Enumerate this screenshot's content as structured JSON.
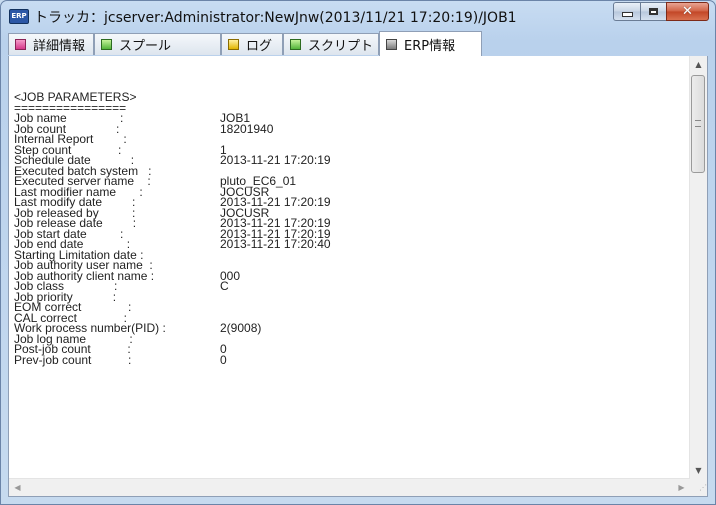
{
  "window": {
    "app_icon_text": "ERP",
    "title": "トラッカ：jcserver:Administrator:NewJnw(2013/11/21 17:20:19)/JOB1",
    "minimize_label": "",
    "maximize_label": "",
    "close_label": "✕"
  },
  "tabs": [
    {
      "label": "詳細情報",
      "icon": "pink"
    },
    {
      "label": "スプール",
      "icon": "green"
    },
    {
      "label": "ログ",
      "icon": "yellow"
    },
    {
      "label": "スクリプト",
      "icon": "green"
    },
    {
      "label": "ERP情報",
      "icon": "gray",
      "active": true
    }
  ],
  "content": {
    "header": "<JOB PARAMETERS>",
    "rule": "================",
    "rows": [
      {
        "key": "Job name                :",
        "value": "JOB1"
      },
      {
        "key": "Job count               :",
        "value": "18201940"
      },
      {
        "key": "Internal Report         :",
        "value": ""
      },
      {
        "key": "Step count              :",
        "value": "1"
      },
      {
        "key": "Schedule date            :",
        "value": "2013-11-21 17:20:19"
      },
      {
        "key": "Executed batch system   :",
        "value": ""
      },
      {
        "key": "Executed server name    :",
        "value": "pluto_EC6_01"
      },
      {
        "key": "Last modifier name       :",
        "value": "JOCUSR"
      },
      {
        "key": "Last modify date         :",
        "value": "2013-11-21 17:20:19"
      },
      {
        "key": "Job released by          :",
        "value": "JOCUSR"
      },
      {
        "key": "Job release date         :",
        "value": "2013-11-21 17:20:19"
      },
      {
        "key": "Job start date          :",
        "value": "2013-11-21 17:20:19"
      },
      {
        "key": "Job end date             :",
        "value": "2013-11-21 17:20:40"
      },
      {
        "key": "Starting Limitation date :",
        "value": ""
      },
      {
        "key": "Job authority user name  :",
        "value": ""
      },
      {
        "key": "Job authority client name :",
        "value": "000"
      },
      {
        "key": "Job class               :",
        "value": "C"
      },
      {
        "key": "Job priority            :",
        "value": ""
      },
      {
        "key": "EOM correct              :",
        "value": ""
      },
      {
        "key": "CAL correct              :",
        "value": ""
      },
      {
        "key": "Work process number(PID) :",
        "value": "2(9008)"
      },
      {
        "key": "Job log name             :",
        "value": ""
      },
      {
        "key": "Post-job count           :",
        "value": "0"
      },
      {
        "key": "Prev-job count           :",
        "value": "0"
      }
    ]
  },
  "scrollbars": {
    "up": "▲",
    "down": "▼",
    "left": "◀",
    "right": "▶",
    "grip": "⋰"
  }
}
